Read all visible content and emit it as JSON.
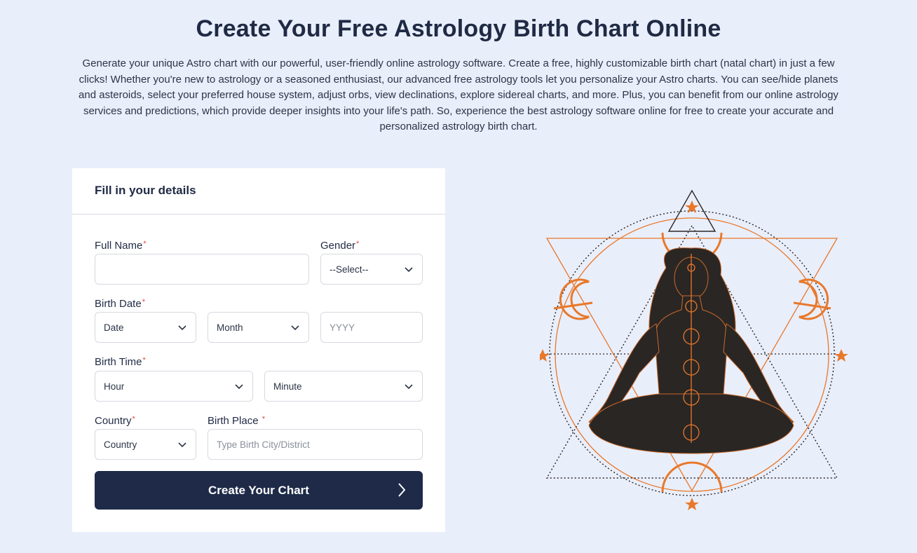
{
  "page": {
    "title": "Create Your Free Astrology Birth Chart Online",
    "intro": "Generate your unique Astro chart with our powerful, user-friendly online astrology software. Create a free, highly customizable birth chart (natal chart) in just a few clicks! Whether you're new to astrology or a seasoned enthusiast, our advanced free astrology tools let you personalize your Astro charts. You can see/hide planets and asteroids, select your preferred house system, adjust orbs, view declinations, explore sidereal charts, and more. Plus, you can benefit from our online astrology services and predictions, which provide deeper insights into your life's path. So, experience the best astrology software online for free to create your accurate and personalized astrology birth chart."
  },
  "form": {
    "heading": "Fill in your details",
    "required_mark": "*",
    "full_name": {
      "label": "Full Name",
      "value": ""
    },
    "gender": {
      "label": "Gender",
      "selected": "--Select--"
    },
    "birth_date": {
      "label": "Birth Date",
      "date_selected": "Date",
      "month_selected": "Month",
      "year_placeholder": "YYYY"
    },
    "birth_time": {
      "label": "Birth Time",
      "hour_selected": "Hour",
      "minute_selected": "Minute"
    },
    "country": {
      "label": "Country",
      "selected": "Country"
    },
    "birth_place": {
      "label": "Birth Place",
      "placeholder": "Type Birth City/District"
    },
    "submit_label": "Create Your Chart"
  },
  "colors": {
    "background": "#e9eefb",
    "button": "#1e2a48",
    "accent_orange": "#e8782a",
    "figure": "#2a2624",
    "required": "#e0463a"
  },
  "icons": {
    "select_arrow": "chevron-down-icon",
    "submit_arrow": "chevron-right-icon",
    "illustration": "meditating-woman-chakra-illustration"
  }
}
